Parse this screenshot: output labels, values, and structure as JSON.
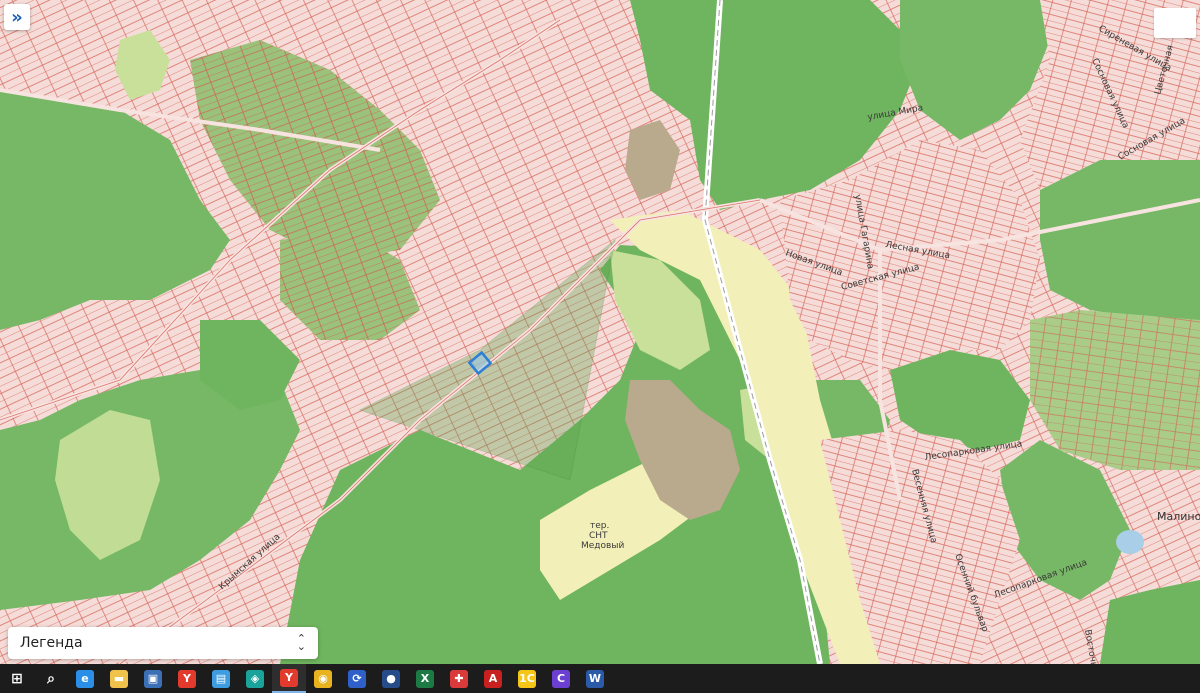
{
  "map": {
    "colors": {
      "background": "#f3d6d3",
      "forest": "#76b865",
      "forest_dark": "#5fa452",
      "meadow": "#c9e09a",
      "sand": "#f3efb9",
      "industrial": "#b9a98d",
      "parcel_outline": "#d8685d",
      "selected_parcel": "#2a7fd6"
    },
    "street_labels": [
      "Крымская улица",
      "улица Мира",
      "улица Гагарина",
      "Лесная улица",
      "Новая улица",
      "Советская улица",
      "Лесопарковая улица",
      "Весенняя улица",
      "Лесопарковая улица",
      "Осенний бульвар",
      "Сиреневая улица",
      "Сосновая улица",
      "Цветочная",
      "Сосновая улица",
      "Восточная"
    ],
    "place_labels": {
      "malino": "Малино",
      "snt_line1": "тер.",
      "snt_line2": "СНТ",
      "snt_line3": "Медовый"
    }
  },
  "controls": {
    "expand_icon": "double-chevron-right-icon",
    "expand_glyph": "»"
  },
  "legend": {
    "label": "Легенда",
    "chevron_up": "⌃",
    "chevron_down": "⌄"
  },
  "taskbar": {
    "items": [
      {
        "name": "windows-start-icon",
        "glyph": "⊞",
        "color": "#ffffff"
      },
      {
        "name": "search-icon",
        "glyph": "⌕",
        "color": "#ffffff"
      },
      {
        "name": "edge-icon",
        "glyph": "e",
        "color": "#2b8fe8"
      },
      {
        "name": "file-explorer-icon",
        "glyph": "▬",
        "color": "#f0c14b"
      },
      {
        "name": "floppy-icon",
        "glyph": "▣",
        "color": "#3b6fb6"
      },
      {
        "name": "yandex-browser-icon",
        "glyph": "Y",
        "color": "#e23b2e"
      },
      {
        "name": "app-blue-icon",
        "glyph": "▤",
        "color": "#3d9de0"
      },
      {
        "name": "app-teal-icon",
        "glyph": "◈",
        "color": "#1aa39a"
      },
      {
        "name": "yandex-browser-active-icon",
        "glyph": "Y",
        "color": "#e23b2e"
      },
      {
        "name": "chrome-icon",
        "glyph": "◉",
        "color": "#e9b21f"
      },
      {
        "name": "app-sync-icon",
        "glyph": "⟳",
        "color": "#2f5fc9"
      },
      {
        "name": "app-orb-icon",
        "glyph": "●",
        "color": "#274c8a"
      },
      {
        "name": "excel-icon",
        "glyph": "X",
        "color": "#1d7a45"
      },
      {
        "name": "app-grid-icon",
        "glyph": "✚",
        "color": "#d93a3a"
      },
      {
        "name": "acrobat-icon",
        "glyph": "A",
        "color": "#c8201e"
      },
      {
        "name": "1c-icon",
        "glyph": "1С",
        "color": "#f5c518"
      },
      {
        "name": "app-c-icon",
        "glyph": "C",
        "color": "#6a3fd1"
      },
      {
        "name": "word-icon",
        "glyph": "W",
        "color": "#2b5aa8"
      }
    ],
    "active_index": 8
  }
}
